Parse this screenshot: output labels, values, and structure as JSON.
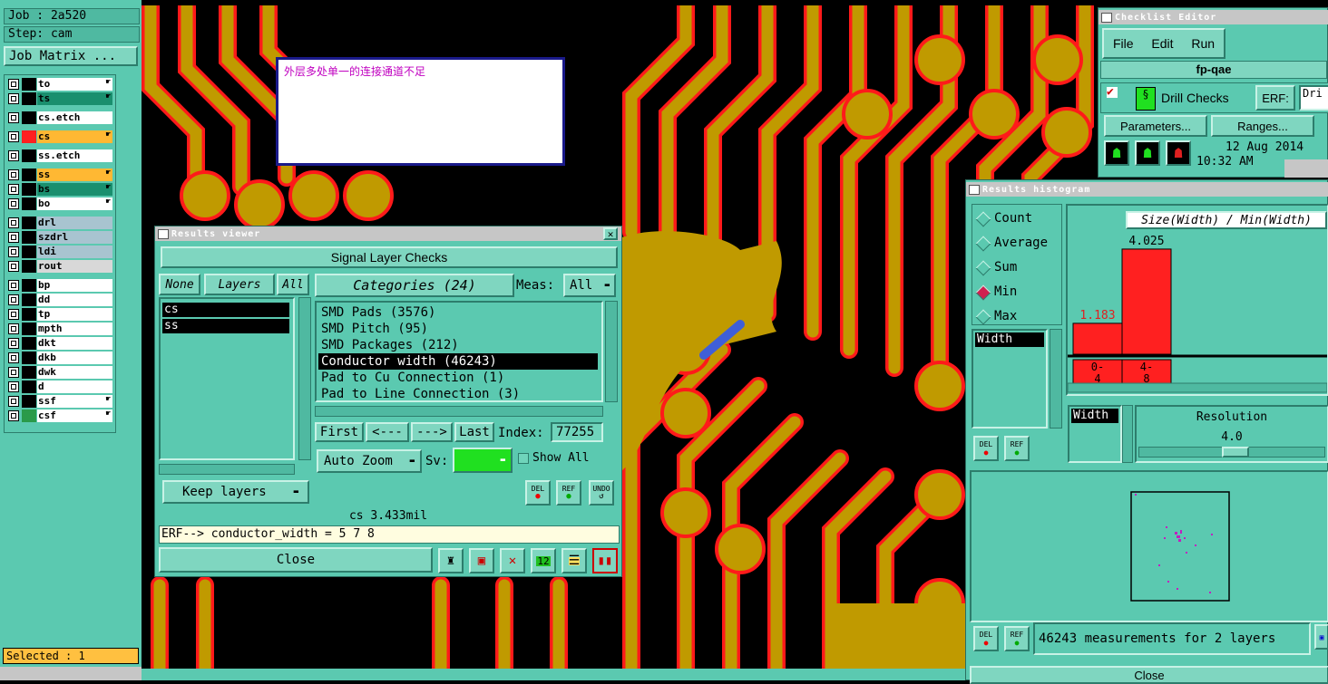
{
  "left_panel": {
    "job": "Job : 2a520",
    "step": "Step: cam",
    "job_matrix_btn": "Job Matrix ...",
    "layers": [
      {
        "name": "to",
        "color": "#000000",
        "fill": "#ffffff",
        "hand": true
      },
      {
        "name": "ts",
        "color": "#000000",
        "fill": "#1a8f6e",
        "hand": true
      },
      {
        "name": "cs.etch",
        "color": "#000000",
        "fill": "#ffffff",
        "hand": false
      },
      {
        "name": "cs",
        "color": "#ff2020",
        "fill": "#ffb833",
        "hand": true
      },
      {
        "name": "ss.etch",
        "color": "#000000",
        "fill": "#ffffff",
        "hand": false
      },
      {
        "name": "ss",
        "color": "#000000",
        "fill": "#ffb833",
        "hand": true
      },
      {
        "name": "bs",
        "color": "#000000",
        "fill": "#1a8f6e",
        "hand": true
      },
      {
        "name": "bo",
        "color": "#000000",
        "fill": "#ffffff",
        "hand": true
      },
      {
        "name": "drl",
        "color": "#000000",
        "fill": "#a8c4d0",
        "hand": false
      },
      {
        "name": "szdrl",
        "color": "#000000",
        "fill": "#a8c4d0",
        "hand": false
      },
      {
        "name": "ldi",
        "color": "#000000",
        "fill": "#a8c4d0",
        "hand": false
      },
      {
        "name": "rout",
        "color": "#000000",
        "fill": "#d8d8d8",
        "hand": false
      },
      {
        "name": "bp",
        "color": "#000000",
        "fill": "#ffffff",
        "hand": false
      },
      {
        "name": "dd",
        "color": "#000000",
        "fill": "#ffffff",
        "hand": false
      },
      {
        "name": "tp",
        "color": "#000000",
        "fill": "#ffffff",
        "hand": false
      },
      {
        "name": "mpth",
        "color": "#000000",
        "fill": "#ffffff",
        "hand": false
      },
      {
        "name": "dkt",
        "color": "#000000",
        "fill": "#ffffff",
        "hand": false
      },
      {
        "name": "dkb",
        "color": "#000000",
        "fill": "#ffffff",
        "hand": false
      },
      {
        "name": "dwk",
        "color": "#000000",
        "fill": "#ffffff",
        "hand": false
      },
      {
        "name": "d",
        "color": "#000000",
        "fill": "#ffffff",
        "hand": false
      },
      {
        "name": "ssf",
        "color": "#000000",
        "fill": "#ffffff",
        "hand": true
      },
      {
        "name": "csf",
        "color": "#2a9a4a",
        "fill": "#ffffff",
        "hand": true
      }
    ],
    "selected": "Selected : 1"
  },
  "note_text": "外层多处单一的连接通道不足",
  "results_viewer": {
    "title": "Results viewer",
    "header": "Signal Layer Checks",
    "none_btn": "None",
    "layers_btn": "Layers",
    "all_btn": "All",
    "categories_btn": "Categories (24)",
    "meas_label": "Meas:",
    "meas_value": "All",
    "layer_list": [
      "cs",
      "ss"
    ],
    "categories": [
      "SMD Pads (3576)",
      "SMD Pitch (95)",
      "SMD Packages (212)",
      "Conductor width (46243)",
      "Pad to Cu Connection (1)",
      "Pad to Line Connection (3)"
    ],
    "selected_category": "Conductor width (46243)",
    "first_btn": "First",
    "prev_btn": "<---",
    "next_btn": "--->",
    "last_btn": "Last",
    "index_label": "Index:",
    "index_value": "77255",
    "auto_zoom": "Auto Zoom",
    "sv_label": "Sv:",
    "show_all": "Show All",
    "keep_layers": "Keep layers",
    "del_label": "DEL",
    "ref_label": "REF",
    "undo_label": "UNDO",
    "status": "cs 3.433mil",
    "erf": "ERF--> conductor_width = 5 7 8",
    "close_btn": "Close"
  },
  "checklist_editor": {
    "title": "Checklist Editor",
    "menu": [
      "File",
      "Edit",
      "Run"
    ],
    "checklist_name": "fp-qae",
    "drill_checks": "Drill Checks",
    "erf_label": "ERF:",
    "erf_value": "Dri",
    "parameters_btn": "Parameters...",
    "ranges_btn": "Ranges...",
    "date": "12 Aug 2014",
    "time": "10:32 AM"
  },
  "histogram": {
    "title": "Results histogram",
    "radio": [
      "Count",
      "Average",
      "Sum",
      "Min",
      "Max"
    ],
    "selected_radio": "Min",
    "chart_title": "Size(Width) / Min(Width)",
    "list_item": "Width",
    "list_item2": "Width",
    "resolution_label": "Resolution",
    "resolution_value": "4.0",
    "del_label": "DEL",
    "ref_label": "REF",
    "measurements": "46243 measurements for 2 layers",
    "close_btn": "Close",
    "bar_color": "#ff2020"
  },
  "chart_data": {
    "type": "bar",
    "title": "Size(Width) / Min(Width)",
    "categories": [
      "0-4",
      "4-8"
    ],
    "values": [
      1.183,
      4.025
    ],
    "ylim": [
      0,
      4.3
    ]
  }
}
